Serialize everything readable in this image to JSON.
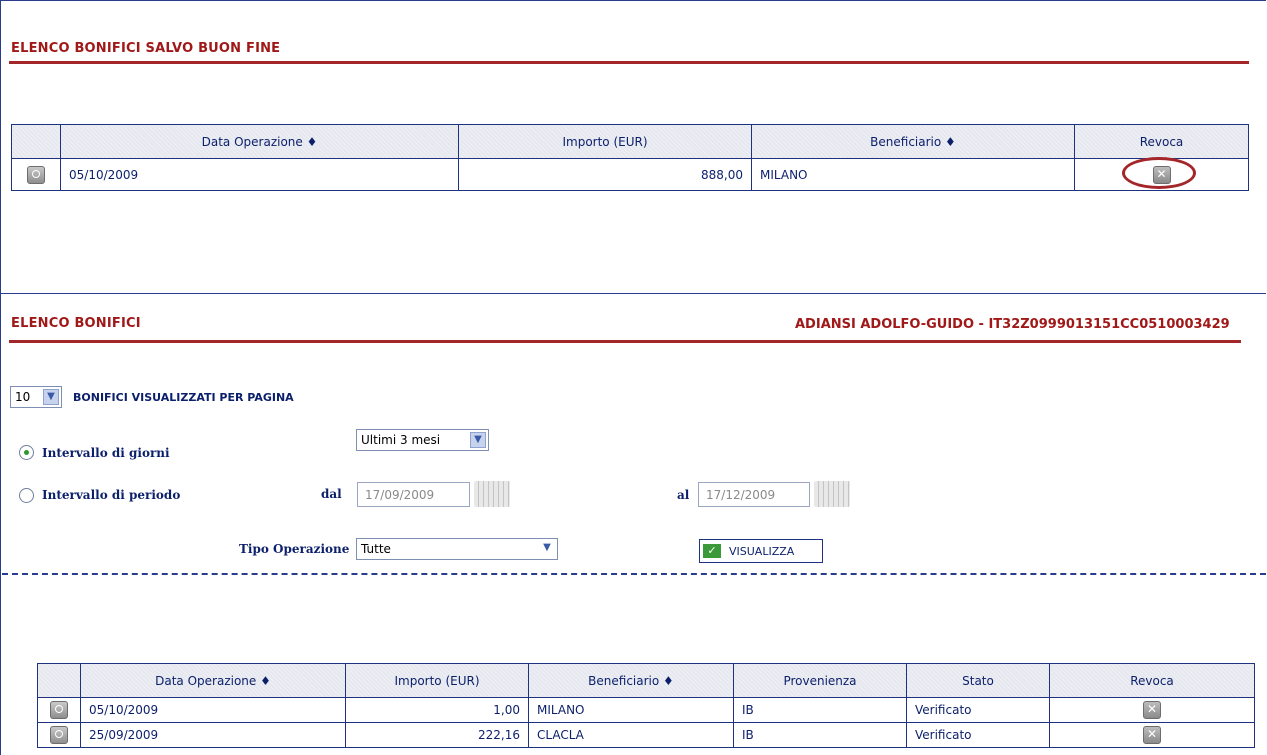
{
  "top_section": {
    "title": "ELENCO BONIFICI SALVO BUON FINE",
    "columns": [
      "Data Operazione ♦",
      "Importo (EUR)",
      "Beneficiario ♦",
      "Revoca"
    ],
    "rows": [
      {
        "data": "05/10/2009",
        "importo": "888,00",
        "beneficiario": "MILANO"
      }
    ]
  },
  "bottom_section": {
    "title": "ELENCO BONIFICI",
    "account": "ADIANSI ADOLFO-GUIDO - IT32Z0999013151CC0510003429",
    "per_page_value": "10",
    "per_page_label": "BONIFICI VISUALIZZATI PER PAGINA",
    "radio_giorni_label": "Intervallo di giorni",
    "radio_periodo_label": "Intervallo di periodo",
    "giorni_select": "Ultimi 3 mesi",
    "dal_label": "dal",
    "dal_value": "17/09/2009",
    "al_label": "al",
    "al_value": "17/12/2009",
    "tipo_label": "Tipo Operazione",
    "tipo_value": "Tutte",
    "visualizza_label": "VISUALIZZA",
    "columns": [
      "Data Operazione ♦",
      "Importo (EUR)",
      "Beneficiario ♦",
      "Provenienza",
      "Stato",
      "Revoca"
    ],
    "rows": [
      {
        "data": "05/10/2009",
        "importo": "1,00",
        "beneficiario": "MILANO",
        "provenienza": "IB",
        "stato": "Verificato"
      },
      {
        "data": "25/09/2009",
        "importo": "222,16",
        "beneficiario": "CLACLA",
        "provenienza": "IB",
        "stato": "Verificato"
      }
    ]
  },
  "colors": {
    "title_red": "#a01818",
    "rule_red": "#a3262a",
    "text_blue": "#0b1f6b",
    "border_blue": "#1f3280"
  },
  "icons": {
    "row_detail": "magnifier-icon",
    "revoke": "close-icon",
    "calendar": "calendar-icon",
    "confirm": "check-icon"
  }
}
